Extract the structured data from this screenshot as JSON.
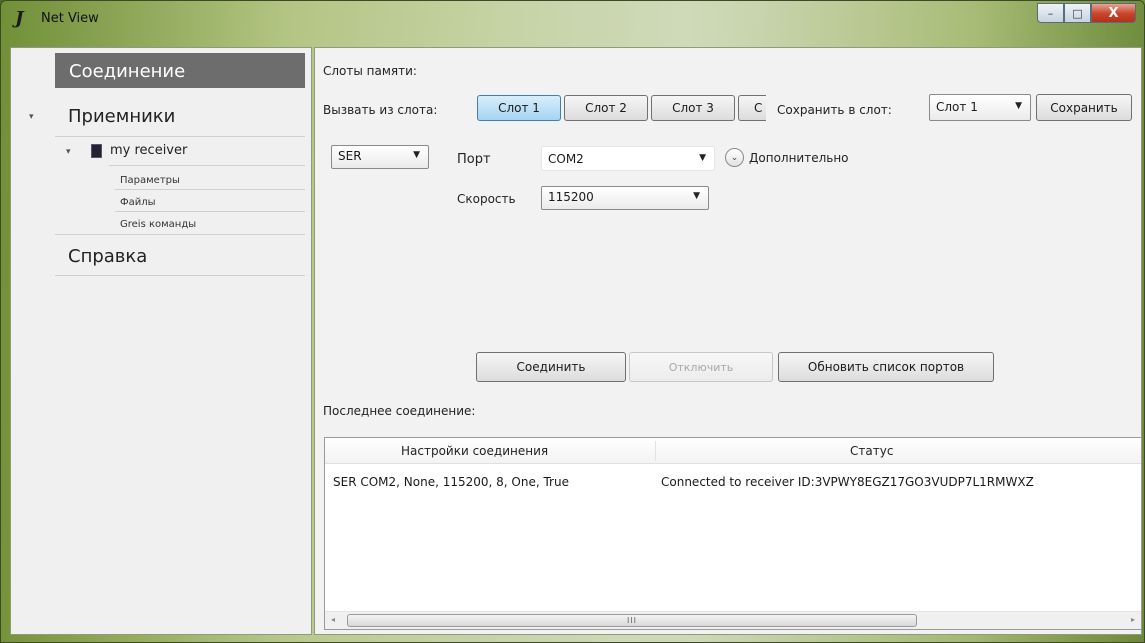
{
  "window": {
    "title": "Net View",
    "app_icon": "J",
    "controls": {
      "minimize": "–",
      "maximize": "□",
      "close": "X"
    }
  },
  "nav": {
    "connection": "Соединение",
    "receivers": "Приемники",
    "receiver_name": "my receiver",
    "receiver_sub": [
      "Параметры",
      "Файлы",
      "Greis команды"
    ],
    "help": "Справка",
    "expander_icon": "▾"
  },
  "slots": {
    "title": "Слоты памяти:",
    "load_label": "Вызвать из слота:",
    "slot_buttons": [
      "Слот 1",
      "Слот 2",
      "Слот 3",
      "С"
    ],
    "active_slot": "Слот 1",
    "save_label": "Сохранить в слот:",
    "save_slot_value": "Слот 1",
    "save_button": "Сохранить"
  },
  "connection": {
    "type_value": "SER",
    "port_label": "Порт",
    "port_value": "COM2",
    "more_label": "Дополнительно",
    "speed_label": "Скорость",
    "speed_value": "115200"
  },
  "actions": {
    "connect": "Соединить",
    "disconnect": "Отключить",
    "refresh_ports": "Обновить список портов"
  },
  "last_connection": {
    "title": "Последнее соединение:",
    "columns": [
      "Настройки соединения",
      "Статус"
    ],
    "rows": [
      [
        "SER COM2, None, 115200, 8, One, True",
        "Connected to receiver ID:3VPWY8EGZ17GO3VUDP7L1RMWXZ"
      ]
    ],
    "scroll_thumb_grip": "III"
  },
  "icons": {
    "dropdown": "▼",
    "chevron_down_circle": "⌄",
    "scroll_left": "◂",
    "scroll_right": "▸"
  }
}
